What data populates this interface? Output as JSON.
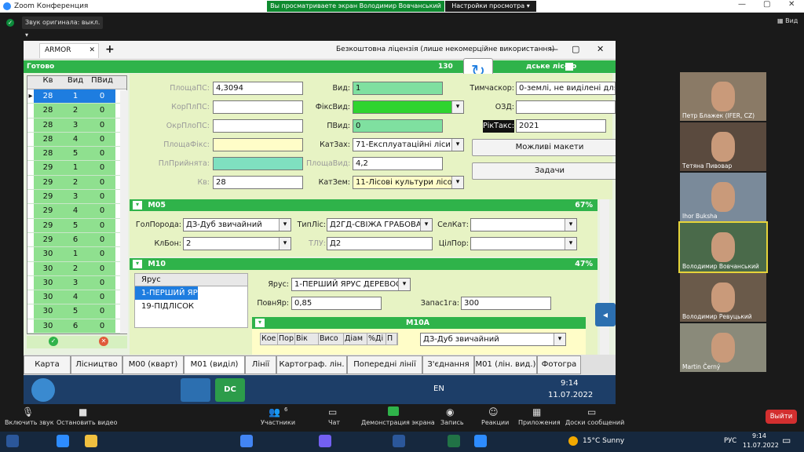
{
  "zoom": {
    "title": "Zoom Конференция",
    "share_banner": "Вы просматриваете экран Володимир Вовчанський",
    "view_settings": "Настройки просмотра",
    "orig_sound": "Звук оригинала: выкл.",
    "view": "Вид",
    "controls": [
      "Включить звук",
      "Остановить видео",
      "Участники",
      "Чат",
      "Демонстрация экрана",
      "Запись",
      "Реакции",
      "Приложения",
      "Доски сообщений"
    ],
    "participants_count": "6",
    "exit": "Выйти"
  },
  "participants": [
    "Петр Блажек (IFER, CZ)",
    "Тетяна Пивовар",
    "Ihor Buksha",
    "Володимир Вовчанський",
    "Володимир Ревуцький",
    "Martin Černý"
  ],
  "teamviewer": {
    "tab": "ARMOR",
    "license": "Безкоштовна ліцензія (лише некомерційне використання)"
  },
  "app": {
    "status": "Готово",
    "counter": "130",
    "title_right": "дське ліс-во",
    "grid": {
      "headers": [
        "Кв",
        "Вид",
        "ПВид"
      ],
      "rows": [
        [
          "28",
          "1",
          "0"
        ],
        [
          "28",
          "2",
          "0"
        ],
        [
          "28",
          "3",
          "0"
        ],
        [
          "28",
          "4",
          "0"
        ],
        [
          "28",
          "5",
          "0"
        ],
        [
          "29",
          "1",
          "0"
        ],
        [
          "29",
          "2",
          "0"
        ],
        [
          "29",
          "3",
          "0"
        ],
        [
          "29",
          "4",
          "0"
        ],
        [
          "29",
          "5",
          "0"
        ],
        [
          "29",
          "6",
          "0"
        ],
        [
          "30",
          "1",
          "0"
        ],
        [
          "30",
          "2",
          "0"
        ],
        [
          "30",
          "3",
          "0"
        ],
        [
          "30",
          "4",
          "0"
        ],
        [
          "30",
          "5",
          "0"
        ],
        [
          "30",
          "6",
          "0"
        ]
      ]
    },
    "form": {
      "ploshcha_ps_label": "ПлощаПС:",
      "ploshcha_ps": "4,3094",
      "kor_pl_ps_label": "КорПлПС:",
      "okr_plo_ps_label": "ОкрПлоПС:",
      "ploshcha_fiks_label": "ПлощаФікс:",
      "pl_pryiniata_label": "ПлПрийнята:",
      "kv_label": "Кв:",
      "kv": "28",
      "vyd_label": "Вид:",
      "vyd": "1",
      "fiks_vyd_label": "ФіксВид:",
      "pvyd_label": "ПВид:",
      "pvyd": "0",
      "kat_zakh_label": "КатЗах:",
      "kat_zakh": "71-Експлуатаційні ліси",
      "ploshcha_vyd_label": "ПлощаВид:",
      "ploshcha_vyd": "4,2",
      "kat_zem_label": "КатЗем:",
      "kat_zem": "11-Лісові культури лісов",
      "tymchaskor_label": "Тимчаскор:",
      "tymchaskor": "0-землі, не виділені для",
      "ozd_label": "ОЗД:",
      "rik_taks_label": "РікТакс:",
      "rik_taks": "2021",
      "btn_layouts": "Можливі макети",
      "btn_tasks": "Задачи"
    },
    "m05": {
      "title": "M05",
      "pct": "67%",
      "gol_poroda_label": "ГолПорода:",
      "gol_poroda": "ДЗ-Дуб звичайний",
      "typ_lis_label": "ТипЛіс:",
      "typ_lis": "Д2ГД-СВІЖА ГРАБОВА Д",
      "sel_kat_label": "СелКат:",
      "kl_bon_label": "КлБон:",
      "kl_bon": "2",
      "tlu_label": "ТЛУ:",
      "tlu": "Д2",
      "tsil_por_label": "ЦілПор:"
    },
    "m10": {
      "title": "M10",
      "pct": "47%",
      "list_header": "Ярус",
      "list": [
        "1-ПЕРШИЙ ЯР",
        "19-ПІДЛІСОК"
      ],
      "yarus_label": "Ярус:",
      "yarus": "1-ПЕРШИЙ ЯРУС ДЕРЕВОС",
      "povn_yar_label": "ПовнЯр:",
      "povn_yar": "0,85",
      "zapas_label": "Запас1га:",
      "zapas": "300"
    },
    "m10a": {
      "title": "M10A",
      "cols": [
        "Кое",
        "Пор",
        "Вік",
        "Висо",
        "Діам",
        "%Ді",
        "П"
      ],
      "species": "ДЗ-Дуб звичайний"
    },
    "tabs": [
      "Карта",
      "Лісництво",
      "M00 (кварт)",
      "M01 (виділ)",
      "Лінії",
      "Картограф. лін.",
      "Попередні лінії",
      "З'єднання",
      "M01 (лін. вид.)",
      "Фотогра"
    ]
  },
  "inner_taskbar": {
    "lang": "EN",
    "time": "9:14",
    "date": "11.07.2022"
  },
  "win_taskbar": {
    "weather": "15°C  Sunny",
    "lang": "РУС",
    "time": "9:14",
    "date": "11.07.2022"
  },
  "colors": {
    "app_green": "#2fb34a",
    "grid_green": "#8fe08f",
    "selection": "#1e7de0",
    "share_green": "#0e8a2f"
  }
}
